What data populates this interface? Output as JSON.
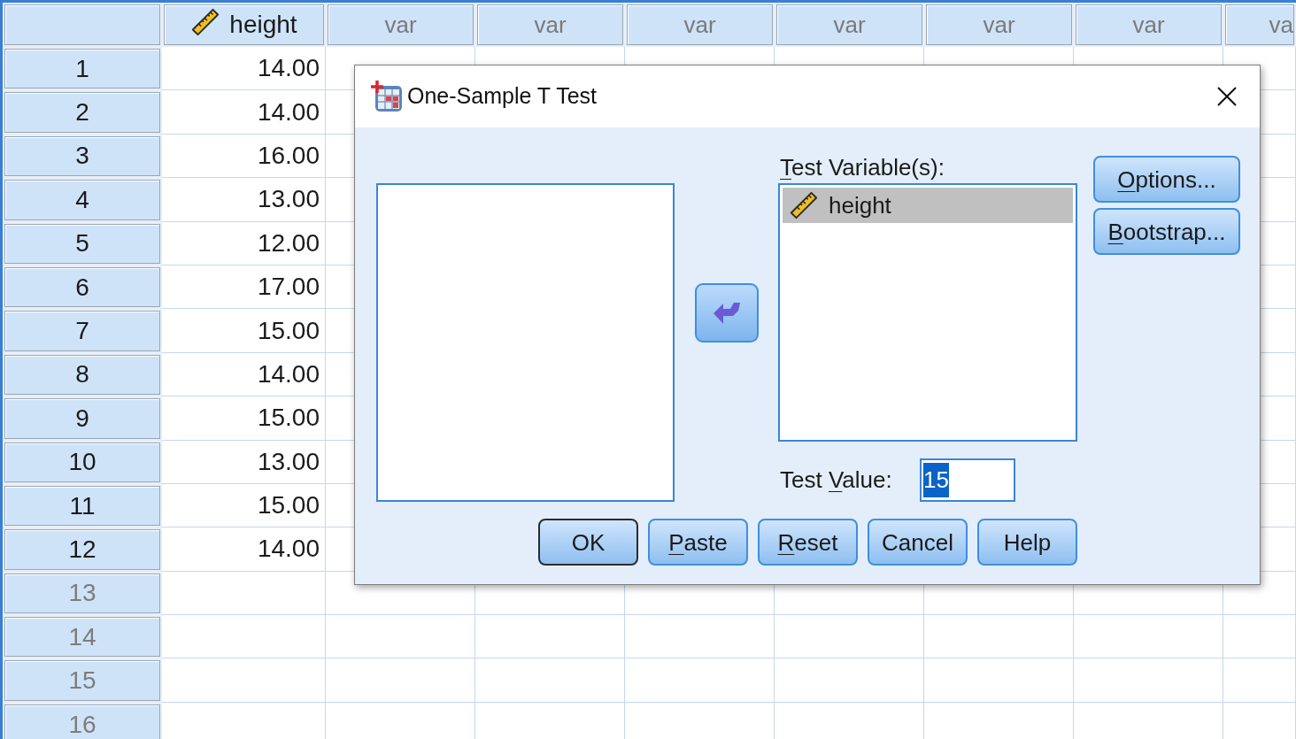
{
  "data_editor": {
    "columns": [
      {
        "label": "height",
        "kind": "variable"
      },
      {
        "label": "var",
        "kind": "empty"
      },
      {
        "label": "var",
        "kind": "empty"
      },
      {
        "label": "var",
        "kind": "empty"
      },
      {
        "label": "var",
        "kind": "empty"
      },
      {
        "label": "var",
        "kind": "empty"
      },
      {
        "label": "var",
        "kind": "empty"
      },
      {
        "label": "va",
        "kind": "empty"
      }
    ],
    "rows": [
      {
        "number": "1",
        "empty": false,
        "values": [
          "14.00"
        ]
      },
      {
        "number": "2",
        "empty": false,
        "values": [
          "14.00"
        ]
      },
      {
        "number": "3",
        "empty": false,
        "values": [
          "16.00"
        ]
      },
      {
        "number": "4",
        "empty": false,
        "values": [
          "13.00"
        ]
      },
      {
        "number": "5",
        "empty": false,
        "values": [
          "12.00"
        ]
      },
      {
        "number": "6",
        "empty": false,
        "values": [
          "17.00"
        ]
      },
      {
        "number": "7",
        "empty": false,
        "values": [
          "15.00"
        ]
      },
      {
        "number": "8",
        "empty": false,
        "values": [
          "14.00"
        ]
      },
      {
        "number": "9",
        "empty": false,
        "values": [
          "15.00"
        ]
      },
      {
        "number": "10",
        "empty": false,
        "values": [
          "13.00"
        ]
      },
      {
        "number": "11",
        "empty": false,
        "values": [
          "15.00"
        ]
      },
      {
        "number": "12",
        "empty": false,
        "values": [
          "14.00"
        ]
      },
      {
        "number": "13",
        "empty": true
      },
      {
        "number": "14",
        "empty": true
      },
      {
        "number": "15",
        "empty": true
      },
      {
        "number": "16",
        "empty": true
      }
    ]
  },
  "dialog": {
    "title": "One-Sample T Test",
    "test_variables": {
      "label": "Test Variable(s):",
      "mnemonic": true,
      "items": [
        {
          "label": "height",
          "selected": true
        }
      ]
    },
    "side_buttons": [
      {
        "label": "Options...",
        "mnemonic": true
      },
      {
        "label": "Bootstrap...",
        "mnemonic": true
      }
    ],
    "test_value": {
      "label": "Test Value:",
      "mnemonic": true,
      "value": "15",
      "text_selected": true
    },
    "buttons": [
      {
        "label": "OK",
        "mnemonic": false,
        "default": true
      },
      {
        "label": "Paste",
        "mnemonic": true,
        "default": false
      },
      {
        "label": "Reset",
        "mnemonic": true,
        "default": false
      },
      {
        "label": "Cancel",
        "mnemonic": false,
        "default": false
      },
      {
        "label": "Help",
        "mnemonic": false,
        "default": false
      }
    ]
  }
}
